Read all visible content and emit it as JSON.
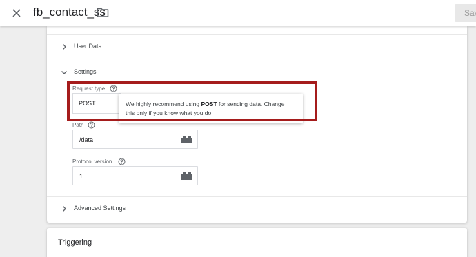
{
  "header": {
    "close_icon": "close-icon",
    "title": "fb_contact_ss",
    "folder_icon": "folder-icon",
    "save_label": "Save"
  },
  "sections": {
    "user_data": {
      "label": "User Data",
      "expanded": false
    },
    "settings": {
      "label": "Settings",
      "expanded": true
    },
    "advanced": {
      "label": "Advanced Settings",
      "expanded": false
    }
  },
  "fields": {
    "request_type": {
      "label": "Request type",
      "value": "POST"
    },
    "path": {
      "label": "Path",
      "value": "/data"
    },
    "protocol_version": {
      "label": "Protocol version",
      "value": "1"
    }
  },
  "tooltip": {
    "before": "We highly recommend using ",
    "bold": "POST",
    "after": " for sending data. Change",
    "line2": "this only if you know what you do."
  },
  "triggering": {
    "label": "Triggering"
  },
  "colors": {
    "highlight": "#a51c1c",
    "background": "#eeeeee"
  }
}
